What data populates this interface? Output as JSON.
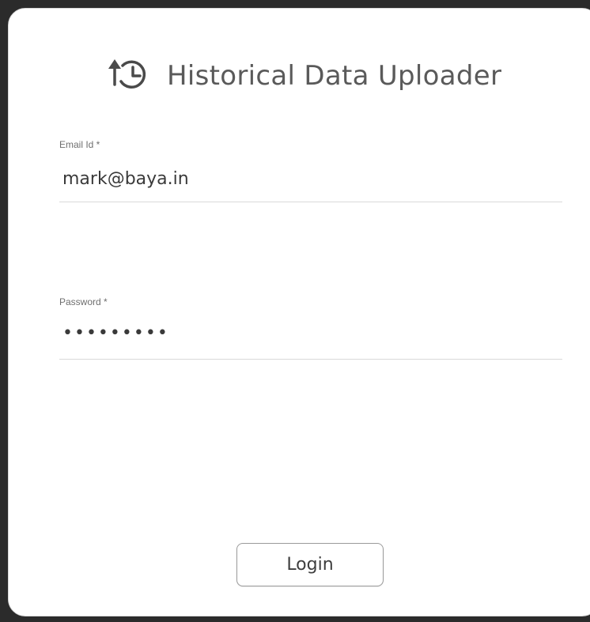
{
  "header": {
    "icon": "history-upload-icon",
    "title": "Historical Data Uploader"
  },
  "form": {
    "email": {
      "label": "Email Id *",
      "value": "mark@baya.in"
    },
    "password": {
      "label": "Password *",
      "value": "•••••••••"
    },
    "login_label": "Login"
  },
  "colors": {
    "title_text": "#5a5a5a",
    "underline": "#d9d9d9",
    "button_border": "#9a9a9a"
  }
}
